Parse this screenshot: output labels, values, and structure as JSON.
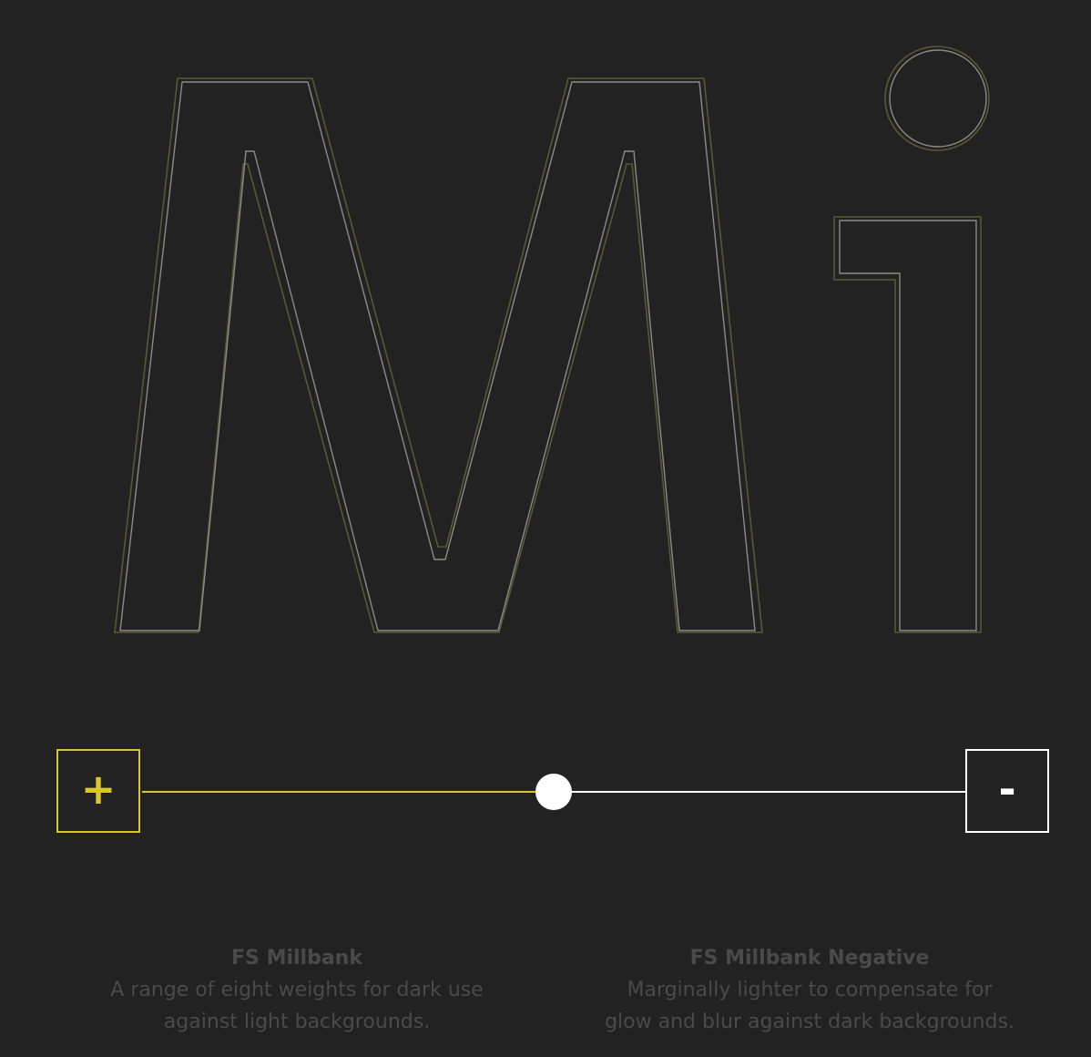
{
  "specimen": {
    "letters": "Mi",
    "outline_regular_color": "#5c5730",
    "outline_negative_color": "#8a8a86"
  },
  "weight_slider": {
    "increase_label": "+",
    "decrease_label": "-",
    "position": 0.5,
    "accent_color": "#d9c928",
    "track_right_color": "#ffffff",
    "thumb_color": "#ffffff"
  },
  "fonts": [
    {
      "title": "FS Millbank",
      "description_line1": "A range of eight weights for dark use",
      "description_line2": "against light backgrounds."
    },
    {
      "title": "FS Millbank Negative",
      "description_line1": "Marginally lighter to compensate for",
      "description_line2": "glow and blur against dark backgrounds."
    }
  ],
  "caption_color": "#4a4a4a",
  "background_color": "#222222"
}
